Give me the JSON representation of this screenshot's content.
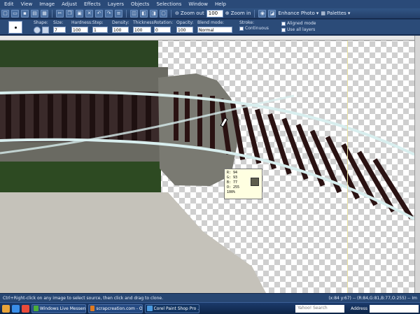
{
  "menu": [
    "Edit",
    "View",
    "Image",
    "Adjust",
    "Effects",
    "Layers",
    "Objects",
    "Selections",
    "Window",
    "Help"
  ],
  "toolbar": {
    "zoom_out": "Zoom out",
    "zoom_in": "Zoom in",
    "enhance": "Enhance Photo",
    "palettes": "Palettes",
    "zoom_value": "100"
  },
  "options": {
    "shape_label": "Shape:",
    "size_label": "Size:",
    "size_value": "7",
    "hardness_label": "Hardness:",
    "hardness_value": "100",
    "step_label": "Step:",
    "step_value": "1",
    "density_label": "Density:",
    "density_value": "100",
    "thickness_label": "Thickness:",
    "thickness_value": "100",
    "rotation_label": "Rotation:",
    "rotation_value": "0",
    "opacity_label": "Opacity:",
    "opacity_value": "100",
    "blend_label": "Blend mode:",
    "blend_value": "Normal",
    "stroke_label": "Stroke:",
    "continuous": "Continuous",
    "aligned": "Aligned mode",
    "all_layers": "Use all layers"
  },
  "readout": {
    "r": "R: 94",
    "g": "G: 93",
    "b": "B: 77",
    "o": "O: 255",
    "pct": "100%",
    "swatch": "#5e5d4d"
  },
  "status": {
    "help": "Ctrl+Right-click on any image to select source, then click and drag to clone.",
    "coords": "(x:84 y:67) -- (R:84,G:81,B:77,O:255)  -- Im"
  },
  "taskbar": {
    "tasks": [
      "Windows Live Messenger",
      "scrapcreation.com - Offlin...",
      "Corel Paint Shop Pro ..."
    ],
    "search": "Yahoo! Search",
    "address": "Address"
  }
}
